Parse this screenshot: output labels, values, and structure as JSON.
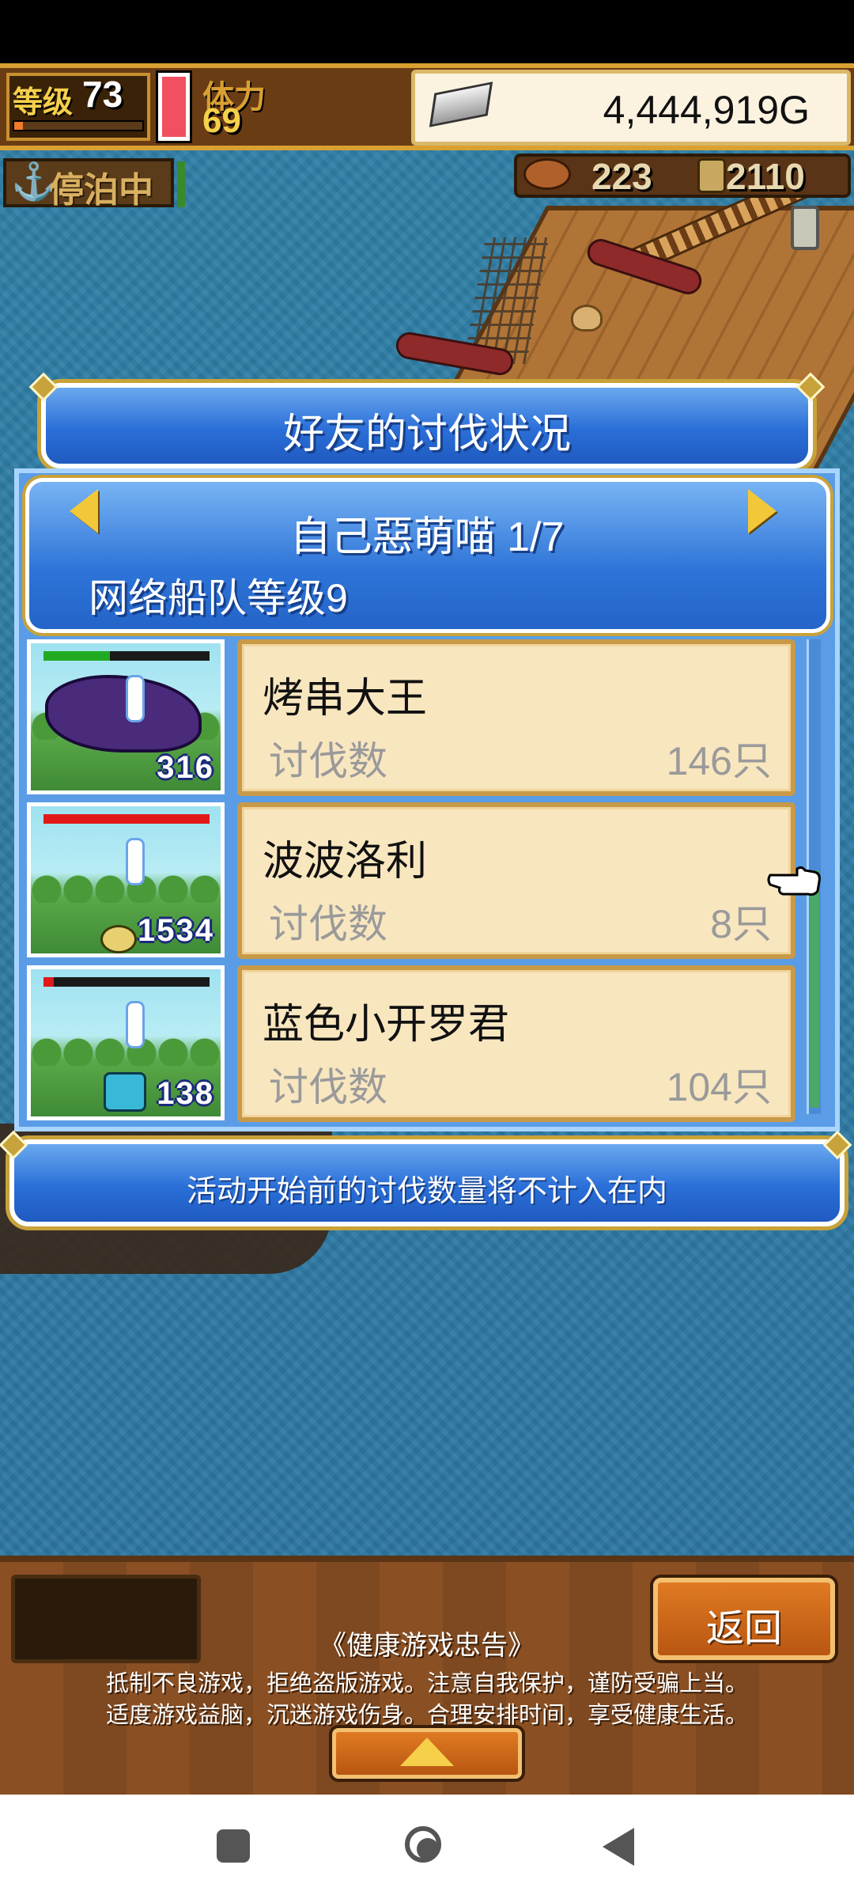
{
  "status": {
    "level_label": "等级",
    "level_value": "73",
    "exp_fraction": 0.07,
    "stamina_label": "体力",
    "stamina_value": "69",
    "gold": "4,444,919G"
  },
  "ship": {
    "moored_label": "停泊中"
  },
  "resources": {
    "res1_value": "223",
    "res2_value": "2110"
  },
  "dialog": {
    "title": "好友的讨伐状况",
    "friend_name": "自己惡萌喵 1/7",
    "fleet_level": "网络船队等级9",
    "rows": [
      {
        "name": "烤串大王",
        "count_label": "讨伐数",
        "count_value": "146只",
        "thumb_number": "316",
        "hp_fraction": 0.4,
        "hp_bar_color": "#22aa22"
      },
      {
        "name": "波波洛利",
        "count_label": "讨伐数",
        "count_value": "8只",
        "thumb_number": "1534",
        "hp_fraction": 1.0,
        "hp_bar_color": "#e01818"
      },
      {
        "name": "蓝色小开罗君",
        "count_label": "讨伐数",
        "count_value": "104只",
        "thumb_number": "138",
        "hp_fraction": 0.06,
        "hp_bar_color": "#e01818"
      }
    ],
    "notice": "活动开始前的讨伐数量将不计入在内"
  },
  "bottom": {
    "back_label": "返回",
    "advice_title": "《健康游戏忠告》",
    "advice_line1": "抵制不良游戏，拒绝盗版游戏。注意自我保护，谨防受骗上当。",
    "advice_line2": "适度游戏益脑，沉迷游戏伤身。合理安排时间，享受健康生活。"
  },
  "colors": {
    "panel_blue": "#2a6fd8",
    "card_cream": "#f8e6bf",
    "gold_accent": "#c8a23a",
    "sea": "#2d7aa3"
  }
}
